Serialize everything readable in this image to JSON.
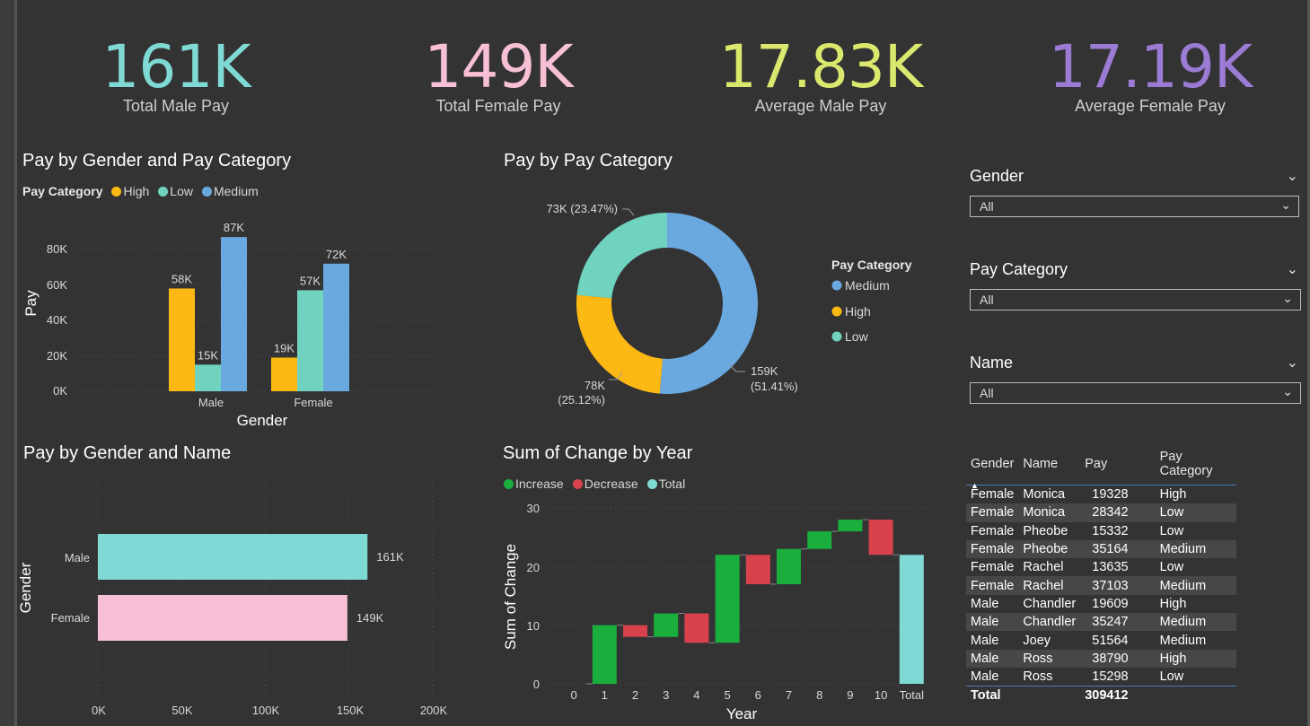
{
  "kpis": [
    {
      "value": "161K",
      "label": "Total Male Pay",
      "color": "#7fd9d4"
    },
    {
      "value": "149K",
      "label": "Total Female Pay",
      "color": "#f7c0d6"
    },
    {
      "value": "17.83K",
      "label": "Average Male Pay",
      "color": "#dbe86e"
    },
    {
      "value": "17.19K",
      "label": "Average Female Pay",
      "color": "#9b7bd4"
    }
  ],
  "colors": {
    "high": "#fdb913",
    "low": "#6fd3c0",
    "medium": "#6aa9e0",
    "increase": "#1aaf3c",
    "decrease": "#d9424d",
    "total": "#7fd9d4",
    "male_bar": "#7fd9d4",
    "female_bar": "#f7c0d6"
  },
  "chart1": {
    "title": "Pay by Gender and Pay Category",
    "legend_title": "Pay Category",
    "legend": [
      "High",
      "Low",
      "Medium"
    ],
    "xlabel": "Gender",
    "ylabel": "Pay",
    "y_ticks": [
      "80K",
      "60K",
      "40K",
      "20K",
      "0K"
    ]
  },
  "chart2": {
    "title": "Pay by Pay Category",
    "legend_title": "Pay Category",
    "legend": [
      "Medium",
      "High",
      "Low"
    ],
    "labels": {
      "low": "73K (23.47%)",
      "high_1": "78K",
      "high_2": "(25.12%)",
      "medium_1": "159K",
      "medium_2": "(51.41%)"
    }
  },
  "chart3": {
    "title": "Pay by Gender and Name",
    "ylabel": "Gender",
    "x_ticks": [
      "0K",
      "50K",
      "100K",
      "150K",
      "200K"
    ]
  },
  "chart4": {
    "title": "Sum of Change by Year",
    "legend": [
      "Increase",
      "Decrease",
      "Total"
    ],
    "xlabel": "Year",
    "ylabel": "Sum of Change",
    "y_ticks": [
      "30",
      "20",
      "10",
      "0"
    ]
  },
  "chart_data": [
    {
      "type": "bar",
      "categories": [
        "Male",
        "Female"
      ],
      "series": [
        {
          "name": "High",
          "values": [
            58000,
            19000
          ],
          "labels": [
            "58K",
            "19K"
          ]
        },
        {
          "name": "Low",
          "values": [
            15000,
            57000
          ],
          "labels": [
            "15K",
            "57K"
          ]
        },
        {
          "name": "Medium",
          "values": [
            87000,
            72000
          ],
          "labels": [
            "87K",
            "72K"
          ]
        }
      ],
      "ylim": [
        0,
        90000
      ]
    },
    {
      "type": "pie",
      "categories": [
        "Medium",
        "High",
        "Low"
      ],
      "values": [
        159000,
        78000,
        73000
      ],
      "percent": [
        51.41,
        25.12,
        23.47
      ]
    },
    {
      "type": "bar",
      "orientation": "horizontal",
      "categories": [
        "Male",
        "Female"
      ],
      "values": [
        161000,
        149000
      ],
      "labels": [
        "161K",
        "149K"
      ],
      "xlim": [
        0,
        200000
      ]
    },
    {
      "type": "bar",
      "subtype": "waterfall",
      "categories": [
        "0",
        "1",
        "2",
        "3",
        "4",
        "5",
        "6",
        "7",
        "8",
        "9",
        "10",
        "Total"
      ],
      "deltas": [
        0,
        10,
        -2,
        4,
        -5,
        15,
        -5,
        6,
        3,
        2,
        -6,
        22
      ],
      "ylim": [
        0,
        30
      ]
    }
  ],
  "slicers": [
    {
      "label": "Gender",
      "value": "All"
    },
    {
      "label": "Pay Category",
      "value": "All"
    },
    {
      "label": "Name",
      "value": "All"
    }
  ],
  "table": {
    "headers": [
      "Gender",
      "Name",
      "Pay",
      "Pay Category"
    ],
    "rows": [
      [
        "Female",
        "Monica",
        "19328",
        "High"
      ],
      [
        "Female",
        "Monica",
        "28342",
        "Low"
      ],
      [
        "Female",
        "Pheobe",
        "15332",
        "Low"
      ],
      [
        "Female",
        "Pheobe",
        "35164",
        "Medium"
      ],
      [
        "Female",
        "Rachel",
        "13635",
        "Low"
      ],
      [
        "Female",
        "Rachel",
        "37103",
        "Medium"
      ],
      [
        "Male",
        "Chandler",
        "19609",
        "High"
      ],
      [
        "Male",
        "Chandler",
        "35247",
        "Medium"
      ],
      [
        "Male",
        "Joey",
        "51564",
        "Medium"
      ],
      [
        "Male",
        "Ross",
        "38790",
        "High"
      ],
      [
        "Male",
        "Ross",
        "15298",
        "Low"
      ]
    ],
    "total_label": "Total",
    "total_value": "309412"
  }
}
